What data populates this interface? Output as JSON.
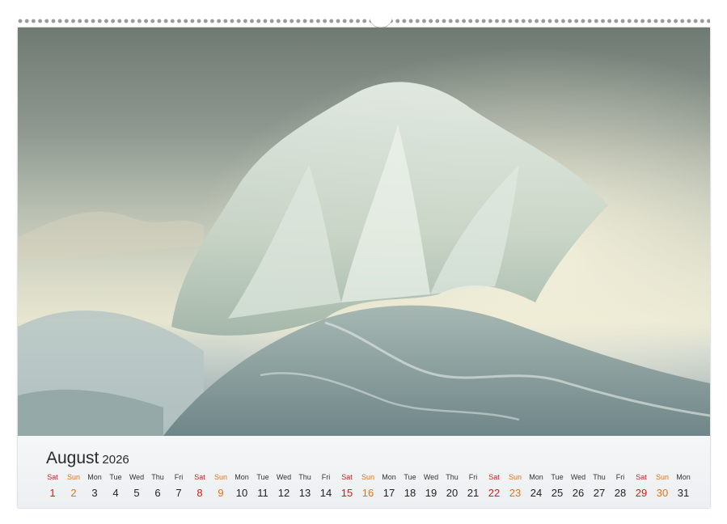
{
  "calendar": {
    "month": "August",
    "year": "2026",
    "days": [
      {
        "name": "Sat",
        "num": "1",
        "type": "sat"
      },
      {
        "name": "Sun",
        "num": "2",
        "type": "sun"
      },
      {
        "name": "Mon",
        "num": "3",
        "type": "wd"
      },
      {
        "name": "Tue",
        "num": "4",
        "type": "wd"
      },
      {
        "name": "Wed",
        "num": "5",
        "type": "wd"
      },
      {
        "name": "Thu",
        "num": "6",
        "type": "wd"
      },
      {
        "name": "Fri",
        "num": "7",
        "type": "wd"
      },
      {
        "name": "Sat",
        "num": "8",
        "type": "sat"
      },
      {
        "name": "Sun",
        "num": "9",
        "type": "sun"
      },
      {
        "name": "Mon",
        "num": "10",
        "type": "wd"
      },
      {
        "name": "Tue",
        "num": "11",
        "type": "wd"
      },
      {
        "name": "Wed",
        "num": "12",
        "type": "wd"
      },
      {
        "name": "Thu",
        "num": "13",
        "type": "wd"
      },
      {
        "name": "Fri",
        "num": "14",
        "type": "wd"
      },
      {
        "name": "Sat",
        "num": "15",
        "type": "sat"
      },
      {
        "name": "Sun",
        "num": "16",
        "type": "sun"
      },
      {
        "name": "Mon",
        "num": "17",
        "type": "wd"
      },
      {
        "name": "Tue",
        "num": "18",
        "type": "wd"
      },
      {
        "name": "Wed",
        "num": "19",
        "type": "wd"
      },
      {
        "name": "Thu",
        "num": "20",
        "type": "wd"
      },
      {
        "name": "Fri",
        "num": "21",
        "type": "wd"
      },
      {
        "name": "Sat",
        "num": "22",
        "type": "sat"
      },
      {
        "name": "Sun",
        "num": "23",
        "type": "sun"
      },
      {
        "name": "Mon",
        "num": "24",
        "type": "wd"
      },
      {
        "name": "Tue",
        "num": "25",
        "type": "wd"
      },
      {
        "name": "Wed",
        "num": "26",
        "type": "wd"
      },
      {
        "name": "Thu",
        "num": "27",
        "type": "wd"
      },
      {
        "name": "Fri",
        "num": "28",
        "type": "wd"
      },
      {
        "name": "Sat",
        "num": "29",
        "type": "sat"
      },
      {
        "name": "Sun",
        "num": "30",
        "type": "sun"
      },
      {
        "name": "Mon",
        "num": "31",
        "type": "wd"
      }
    ]
  },
  "colors": {
    "saturday": "#cc1f1a",
    "sunday": "#e8701a",
    "weekday": "#222222"
  },
  "photo": {
    "subject": "crashing ocean wave"
  }
}
